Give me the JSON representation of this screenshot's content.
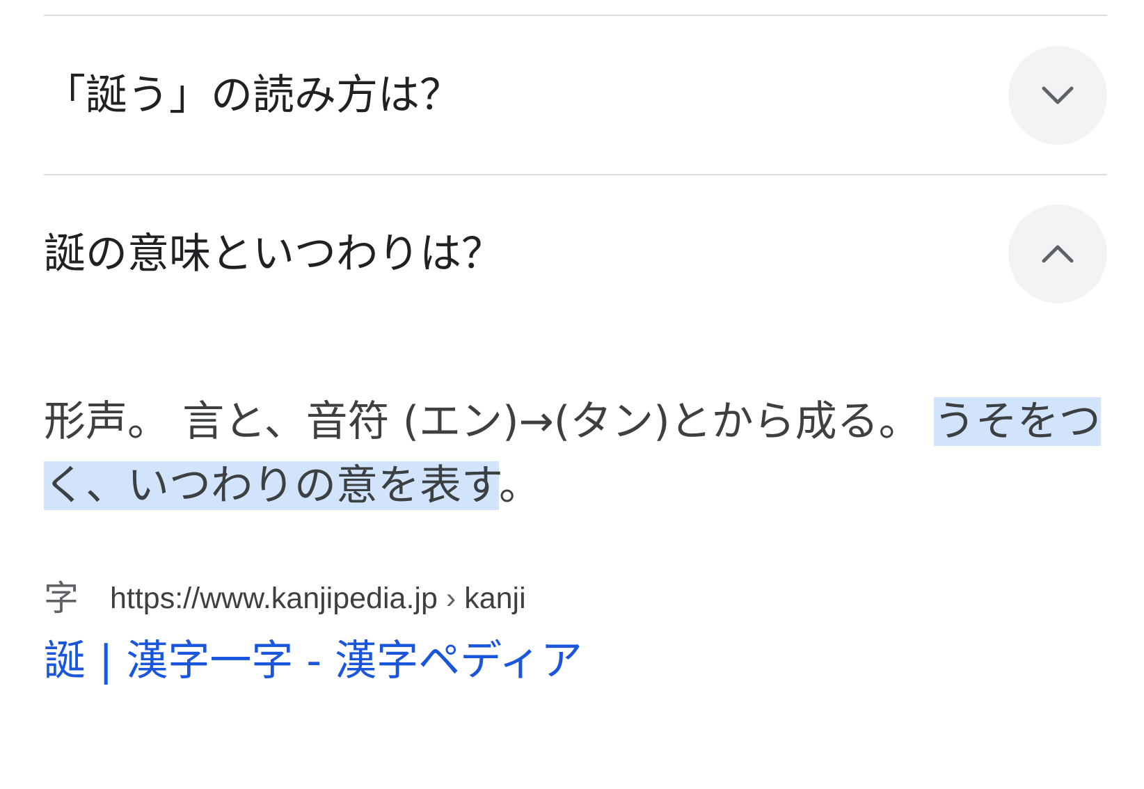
{
  "faq": [
    {
      "question": "「誕う」の読み方は？",
      "state": "collapsed",
      "toggle_icon": "chevron-down-icon"
    },
    {
      "question": "誕の意味といつわりは？",
      "state": "expanded",
      "toggle_icon": "chevron-up-icon",
      "answer": {
        "part1": "形声。 言と、音符 (エン)→(タン)とから成る。 ",
        "highlight": "うそをつく、いつわりの意を表す",
        "part3": "。"
      }
    }
  ],
  "source": {
    "icon": "字",
    "url": "https://www.kanjipedia.jp",
    "separator": "›",
    "path": "kanji"
  },
  "result": {
    "title": "誕 | 漢字一字 - 漢字ペディア"
  },
  "colors": {
    "highlight": "#d2e3fc",
    "link": "#1a56db",
    "button_bg": "#f1f3f4",
    "divider": "#dadce0"
  }
}
